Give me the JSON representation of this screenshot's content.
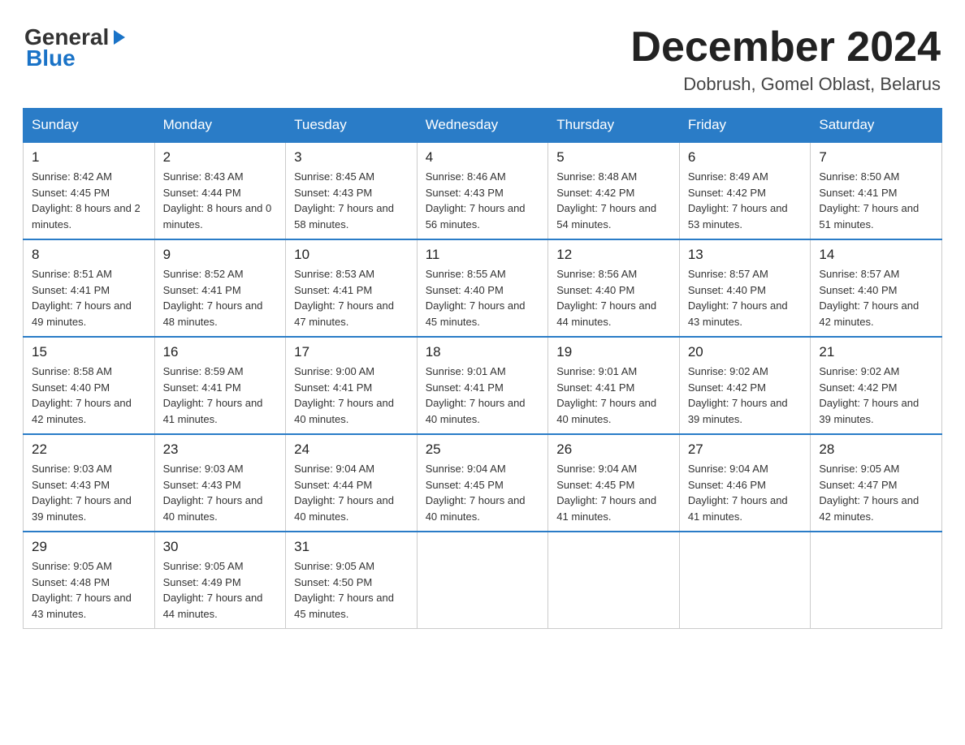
{
  "header": {
    "logo_general": "General",
    "logo_blue": "Blue",
    "month_year": "December 2024",
    "location": "Dobrush, Gomel Oblast, Belarus"
  },
  "weekdays": [
    "Sunday",
    "Monday",
    "Tuesday",
    "Wednesday",
    "Thursday",
    "Friday",
    "Saturday"
  ],
  "weeks": [
    [
      {
        "day": "1",
        "sunrise": "8:42 AM",
        "sunset": "4:45 PM",
        "daylight": "8 hours and 2 minutes."
      },
      {
        "day": "2",
        "sunrise": "8:43 AM",
        "sunset": "4:44 PM",
        "daylight": "8 hours and 0 minutes."
      },
      {
        "day": "3",
        "sunrise": "8:45 AM",
        "sunset": "4:43 PM",
        "daylight": "7 hours and 58 minutes."
      },
      {
        "day": "4",
        "sunrise": "8:46 AM",
        "sunset": "4:43 PM",
        "daylight": "7 hours and 56 minutes."
      },
      {
        "day": "5",
        "sunrise": "8:48 AM",
        "sunset": "4:42 PM",
        "daylight": "7 hours and 54 minutes."
      },
      {
        "day": "6",
        "sunrise": "8:49 AM",
        "sunset": "4:42 PM",
        "daylight": "7 hours and 53 minutes."
      },
      {
        "day": "7",
        "sunrise": "8:50 AM",
        "sunset": "4:41 PM",
        "daylight": "7 hours and 51 minutes."
      }
    ],
    [
      {
        "day": "8",
        "sunrise": "8:51 AM",
        "sunset": "4:41 PM",
        "daylight": "7 hours and 49 minutes."
      },
      {
        "day": "9",
        "sunrise": "8:52 AM",
        "sunset": "4:41 PM",
        "daylight": "7 hours and 48 minutes."
      },
      {
        "day": "10",
        "sunrise": "8:53 AM",
        "sunset": "4:41 PM",
        "daylight": "7 hours and 47 minutes."
      },
      {
        "day": "11",
        "sunrise": "8:55 AM",
        "sunset": "4:40 PM",
        "daylight": "7 hours and 45 minutes."
      },
      {
        "day": "12",
        "sunrise": "8:56 AM",
        "sunset": "4:40 PM",
        "daylight": "7 hours and 44 minutes."
      },
      {
        "day": "13",
        "sunrise": "8:57 AM",
        "sunset": "4:40 PM",
        "daylight": "7 hours and 43 minutes."
      },
      {
        "day": "14",
        "sunrise": "8:57 AM",
        "sunset": "4:40 PM",
        "daylight": "7 hours and 42 minutes."
      }
    ],
    [
      {
        "day": "15",
        "sunrise": "8:58 AM",
        "sunset": "4:40 PM",
        "daylight": "7 hours and 42 minutes."
      },
      {
        "day": "16",
        "sunrise": "8:59 AM",
        "sunset": "4:41 PM",
        "daylight": "7 hours and 41 minutes."
      },
      {
        "day": "17",
        "sunrise": "9:00 AM",
        "sunset": "4:41 PM",
        "daylight": "7 hours and 40 minutes."
      },
      {
        "day": "18",
        "sunrise": "9:01 AM",
        "sunset": "4:41 PM",
        "daylight": "7 hours and 40 minutes."
      },
      {
        "day": "19",
        "sunrise": "9:01 AM",
        "sunset": "4:41 PM",
        "daylight": "7 hours and 40 minutes."
      },
      {
        "day": "20",
        "sunrise": "9:02 AM",
        "sunset": "4:42 PM",
        "daylight": "7 hours and 39 minutes."
      },
      {
        "day": "21",
        "sunrise": "9:02 AM",
        "sunset": "4:42 PM",
        "daylight": "7 hours and 39 minutes."
      }
    ],
    [
      {
        "day": "22",
        "sunrise": "9:03 AM",
        "sunset": "4:43 PM",
        "daylight": "7 hours and 39 minutes."
      },
      {
        "day": "23",
        "sunrise": "9:03 AM",
        "sunset": "4:43 PM",
        "daylight": "7 hours and 40 minutes."
      },
      {
        "day": "24",
        "sunrise": "9:04 AM",
        "sunset": "4:44 PM",
        "daylight": "7 hours and 40 minutes."
      },
      {
        "day": "25",
        "sunrise": "9:04 AM",
        "sunset": "4:45 PM",
        "daylight": "7 hours and 40 minutes."
      },
      {
        "day": "26",
        "sunrise": "9:04 AM",
        "sunset": "4:45 PM",
        "daylight": "7 hours and 41 minutes."
      },
      {
        "day": "27",
        "sunrise": "9:04 AM",
        "sunset": "4:46 PM",
        "daylight": "7 hours and 41 minutes."
      },
      {
        "day": "28",
        "sunrise": "9:05 AM",
        "sunset": "4:47 PM",
        "daylight": "7 hours and 42 minutes."
      }
    ],
    [
      {
        "day": "29",
        "sunrise": "9:05 AM",
        "sunset": "4:48 PM",
        "daylight": "7 hours and 43 minutes."
      },
      {
        "day": "30",
        "sunrise": "9:05 AM",
        "sunset": "4:49 PM",
        "daylight": "7 hours and 44 minutes."
      },
      {
        "day": "31",
        "sunrise": "9:05 AM",
        "sunset": "4:50 PM",
        "daylight": "7 hours and 45 minutes."
      },
      null,
      null,
      null,
      null
    ]
  ]
}
